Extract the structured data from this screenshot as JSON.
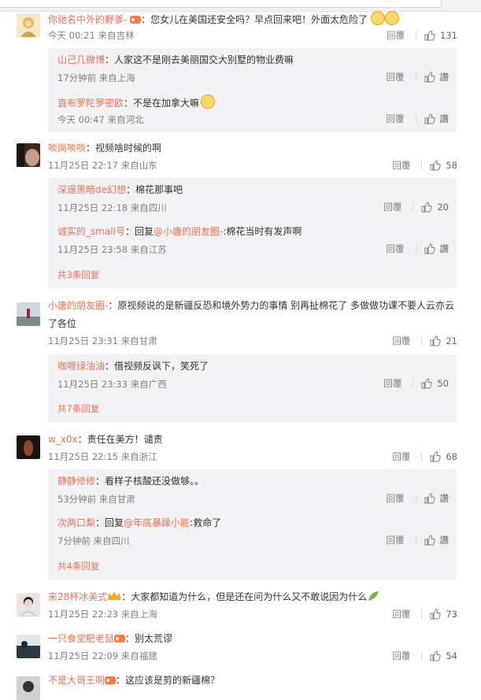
{
  "colors": {
    "accent": "#eb7350",
    "meta": "#808080",
    "sub_bg": "#f2f2f5"
  },
  "comments": [
    {
      "name": "你驰名中外的野爹-",
      "text": "：您女儿在美国还安全吗？早点回来吧！外面太危险了",
      "meta": "今天 00:21 来自吉林",
      "reply": "回覆",
      "likes": "131",
      "subs": [
        {
          "name": "山己几微博",
          "text": "：人家这不是刚去美丽国交大别墅的物业费嘛",
          "meta": "17分钟前 来自上海",
          "reply": "回覆",
          "likes": "讚"
        },
        {
          "name": "直布罗陀罗密欧",
          "text": "：不是在加拿大嘛",
          "meta": "今天 00:47 来自河北",
          "reply": "回覆",
          "likes": "讚"
        }
      ]
    },
    {
      "name": "啖岗啖啖",
      "text": "：视频啥时候的啊",
      "meta": "11月25日 22:17 来自山东",
      "reply": "回覆",
      "likes": "58",
      "subs": [
        {
          "name": "深邃黑暗de幻想",
          "text": "：棉花那事吧",
          "meta": "11月25日 22:18 来自四川",
          "reply": "回覆",
          "likes": "20"
        },
        {
          "name": "诚实的_small号",
          "text_pre": "：回复",
          "mention": "@小唐的朋友圈-",
          "text": ":棉花当时有发声啊",
          "meta": "11月25日 23:58 来自江苏",
          "reply": "回覆",
          "likes": "讚"
        }
      ],
      "more": "共3条回复"
    },
    {
      "name": "小唐的朋友圈-",
      "text": "：原视频说的是新疆反恐和境外势力的事情 别再扯棉花了 多做做功课不要人云亦云",
      "text2": "了各位",
      "meta": "11月25日 23:31 来自甘肃",
      "reply": "回覆",
      "likes": "21",
      "subs": [
        {
          "name": "咖喱绿油油",
          "text": "：借视频反讽下，笑死了",
          "meta": "11月25日 23:33 来自广西",
          "reply": "回覆",
          "likes": "50"
        }
      ],
      "more": "共7条回复"
    },
    {
      "name": "w_x0x",
      "text": "：责任在美方！谴责",
      "meta": "11月25日 22:15 来自浙江",
      "reply": "回覆",
      "likes": "68",
      "subs": [
        {
          "name": "静静修修",
          "text": "：看样子核酸还没做够。。",
          "meta": "53分钟前 来自甘肃",
          "reply": "回覆",
          "likes": "讚"
        },
        {
          "name": "次两口梨",
          "text_pre": "：回复",
          "mention": "@年底暴躁小能",
          "text": ":救命了",
          "meta": "7分钟前 来自四川",
          "reply": "回覆",
          "likes": "讚"
        }
      ],
      "more": "共4条回复"
    },
    {
      "name": "来28杯冰美式",
      "text": "：大家都知道为什么，但是还在问为什么又不敢说因为什么",
      "meta": "11月25日 22:23 来自上海",
      "reply": "回覆",
      "likes": "73"
    },
    {
      "name": "一只食堂肥老鼠",
      "text": "：别太荒谬",
      "meta": "11月25日 22:09 来自福建",
      "reply": "回覆",
      "likes": "54"
    },
    {
      "name": "不是大哥王啊",
      "text": "：这应该是剪的新疆棉？",
      "meta": "",
      "reply": "",
      "likes": ""
    }
  ]
}
